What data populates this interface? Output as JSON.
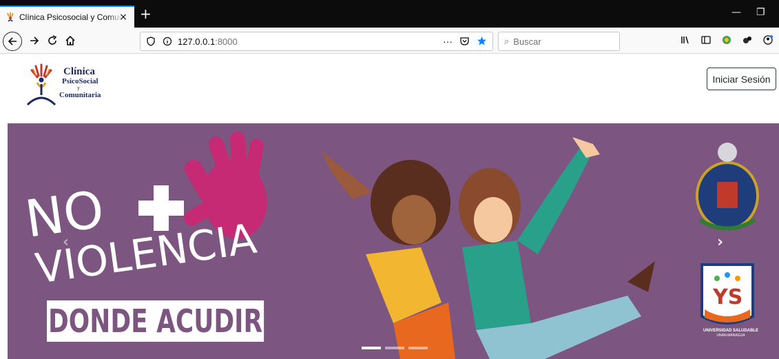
{
  "browser": {
    "tab_title": "Clínica Psicosocial y Comunitaria",
    "tab_close": "×",
    "new_tab": "+",
    "url_host": "127.0.0.1",
    "url_port": ":8000",
    "search_placeholder": "Buscar",
    "url_more": "···"
  },
  "header": {
    "logo_line1": "Clínica",
    "logo_line2": "PsicoSocial",
    "logo_line3": "y",
    "logo_line4": "Comunitaria",
    "login_label": "Iniciar Sesión"
  },
  "carousel": {
    "slide_text_1": "NO",
    "slide_text_2": "VIOLENCIA",
    "slide_button_text": "DONDE ACUDIR",
    "univ_label": "UNIVERSIDAD SALUDABLE",
    "univ_sublabel": "UNAN-MANAGUA",
    "prev": "‹",
    "next": "›",
    "indicator_count": 3,
    "active_indicator": 1
  },
  "colors": {
    "slide_bg": "#7c5580",
    "accent": "#0a84ff"
  }
}
